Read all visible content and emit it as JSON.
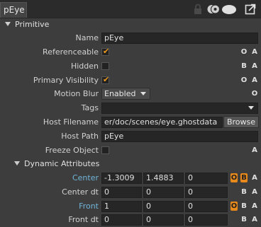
{
  "tab": {
    "label": "pEye"
  },
  "toolbar_icons": [
    "lock-icon",
    "view-mode-icon",
    "toggle-pill-icon",
    "popout-icon"
  ],
  "sections": {
    "primitive": "Primitive",
    "dynamic": "Dynamic Attributes"
  },
  "rows": {
    "name": {
      "label": "Name",
      "value": "pEye"
    },
    "referenceable": {
      "label": "Referenceable",
      "checked": true,
      "badges": [
        "O",
        "A"
      ]
    },
    "hidden": {
      "label": "Hidden",
      "checked": false,
      "badges": [
        "B",
        "A"
      ]
    },
    "primary_visibility": {
      "label": "Primary Visibility",
      "checked": true,
      "badges": [
        "O",
        "A"
      ]
    },
    "motion_blur": {
      "label": "Motion Blur",
      "value": "Enabled",
      "badges": [
        "O"
      ]
    },
    "tags": {
      "label": "Tags",
      "value": ""
    },
    "host_filename": {
      "label": "Host Filename",
      "value": "er/doc/scenes/eye.ghostdata",
      "button": "Browse"
    },
    "host_path": {
      "label": "Host Path",
      "value": "pEye"
    },
    "freeze_object": {
      "label": "Freeze Object",
      "checked": false,
      "badges": [
        "A"
      ]
    },
    "center": {
      "label": "Center",
      "values": [
        "-1.3009",
        "1.4883",
        "0"
      ],
      "badges": [
        "O",
        "B",
        "A"
      ]
    },
    "center_dt": {
      "label": "Center  dt",
      "values": [
        "0",
        "0",
        "0"
      ],
      "badges": [
        "B",
        "A"
      ]
    },
    "front": {
      "label": "Front",
      "values": [
        "1",
        "0",
        "0"
      ],
      "badges": [
        "O",
        "B",
        "A"
      ]
    },
    "front_dt": {
      "label": "Front  dt",
      "values": [
        "0",
        "0",
        "0"
      ],
      "badges": [
        "B",
        "A"
      ]
    }
  },
  "colors": {
    "accent": "#e8891c",
    "link": "#6fb5d8",
    "checkmark": "#f29a1f"
  }
}
